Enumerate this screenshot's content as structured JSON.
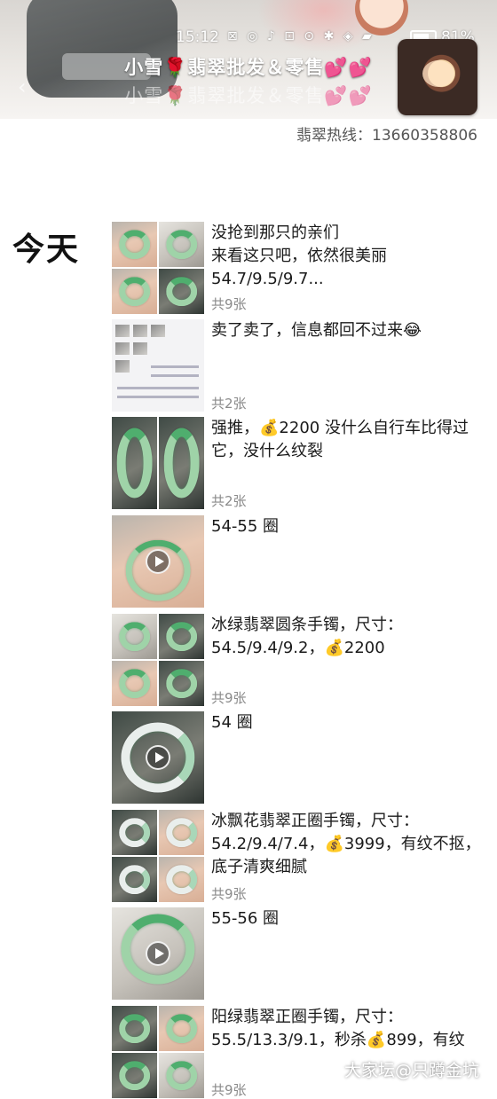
{
  "status_bar": {
    "time": "15:12",
    "icons": "⊠ ◎ ♪ ⊡ ⊙ ✱ ◈ ▰",
    "battery": "81%"
  },
  "header": {
    "title": "小雪🌹翡翠批发＆零售💕💕",
    "title_ghost": "小雪🌹翡翠批发＆零售💕💕",
    "back_icon": "‹"
  },
  "hotline": "翡翠热线：13660358806",
  "day_label": "今天",
  "posts": [
    {
      "text": "没抢到那只的亲们\n来看这只吧，依然很美丽\n54.7/9.5/9.7...",
      "count": "共9张"
    },
    {
      "text": "卖了卖了，信息都回不过来😂",
      "count": "共2张"
    },
    {
      "text": "强推，💰2200 没什么自行车比得过它，没什么纹裂",
      "count": "共2张"
    },
    {
      "text": "54-55 圈",
      "count": ""
    },
    {
      "text": "冰绿翡翠圆条手镯，尺寸：\n54.5/9.4/9.2，💰2200",
      "count": "共9张"
    },
    {
      "text": "54 圈",
      "count": ""
    },
    {
      "text": "冰飘花翡翠正圈手镯，尺寸：\n54.2/9.4/7.4，💰3999，有纹不抠，底子清爽细腻",
      "count": "共9张"
    },
    {
      "text": "55-56 圈",
      "count": ""
    },
    {
      "text": "阳绿翡翠正圈手镯，尺寸：\n55.5/13.3/9.1，秒杀💰899，有纹",
      "count": "共9张"
    }
  ],
  "watermark": "大家坛@只蹲金坑"
}
